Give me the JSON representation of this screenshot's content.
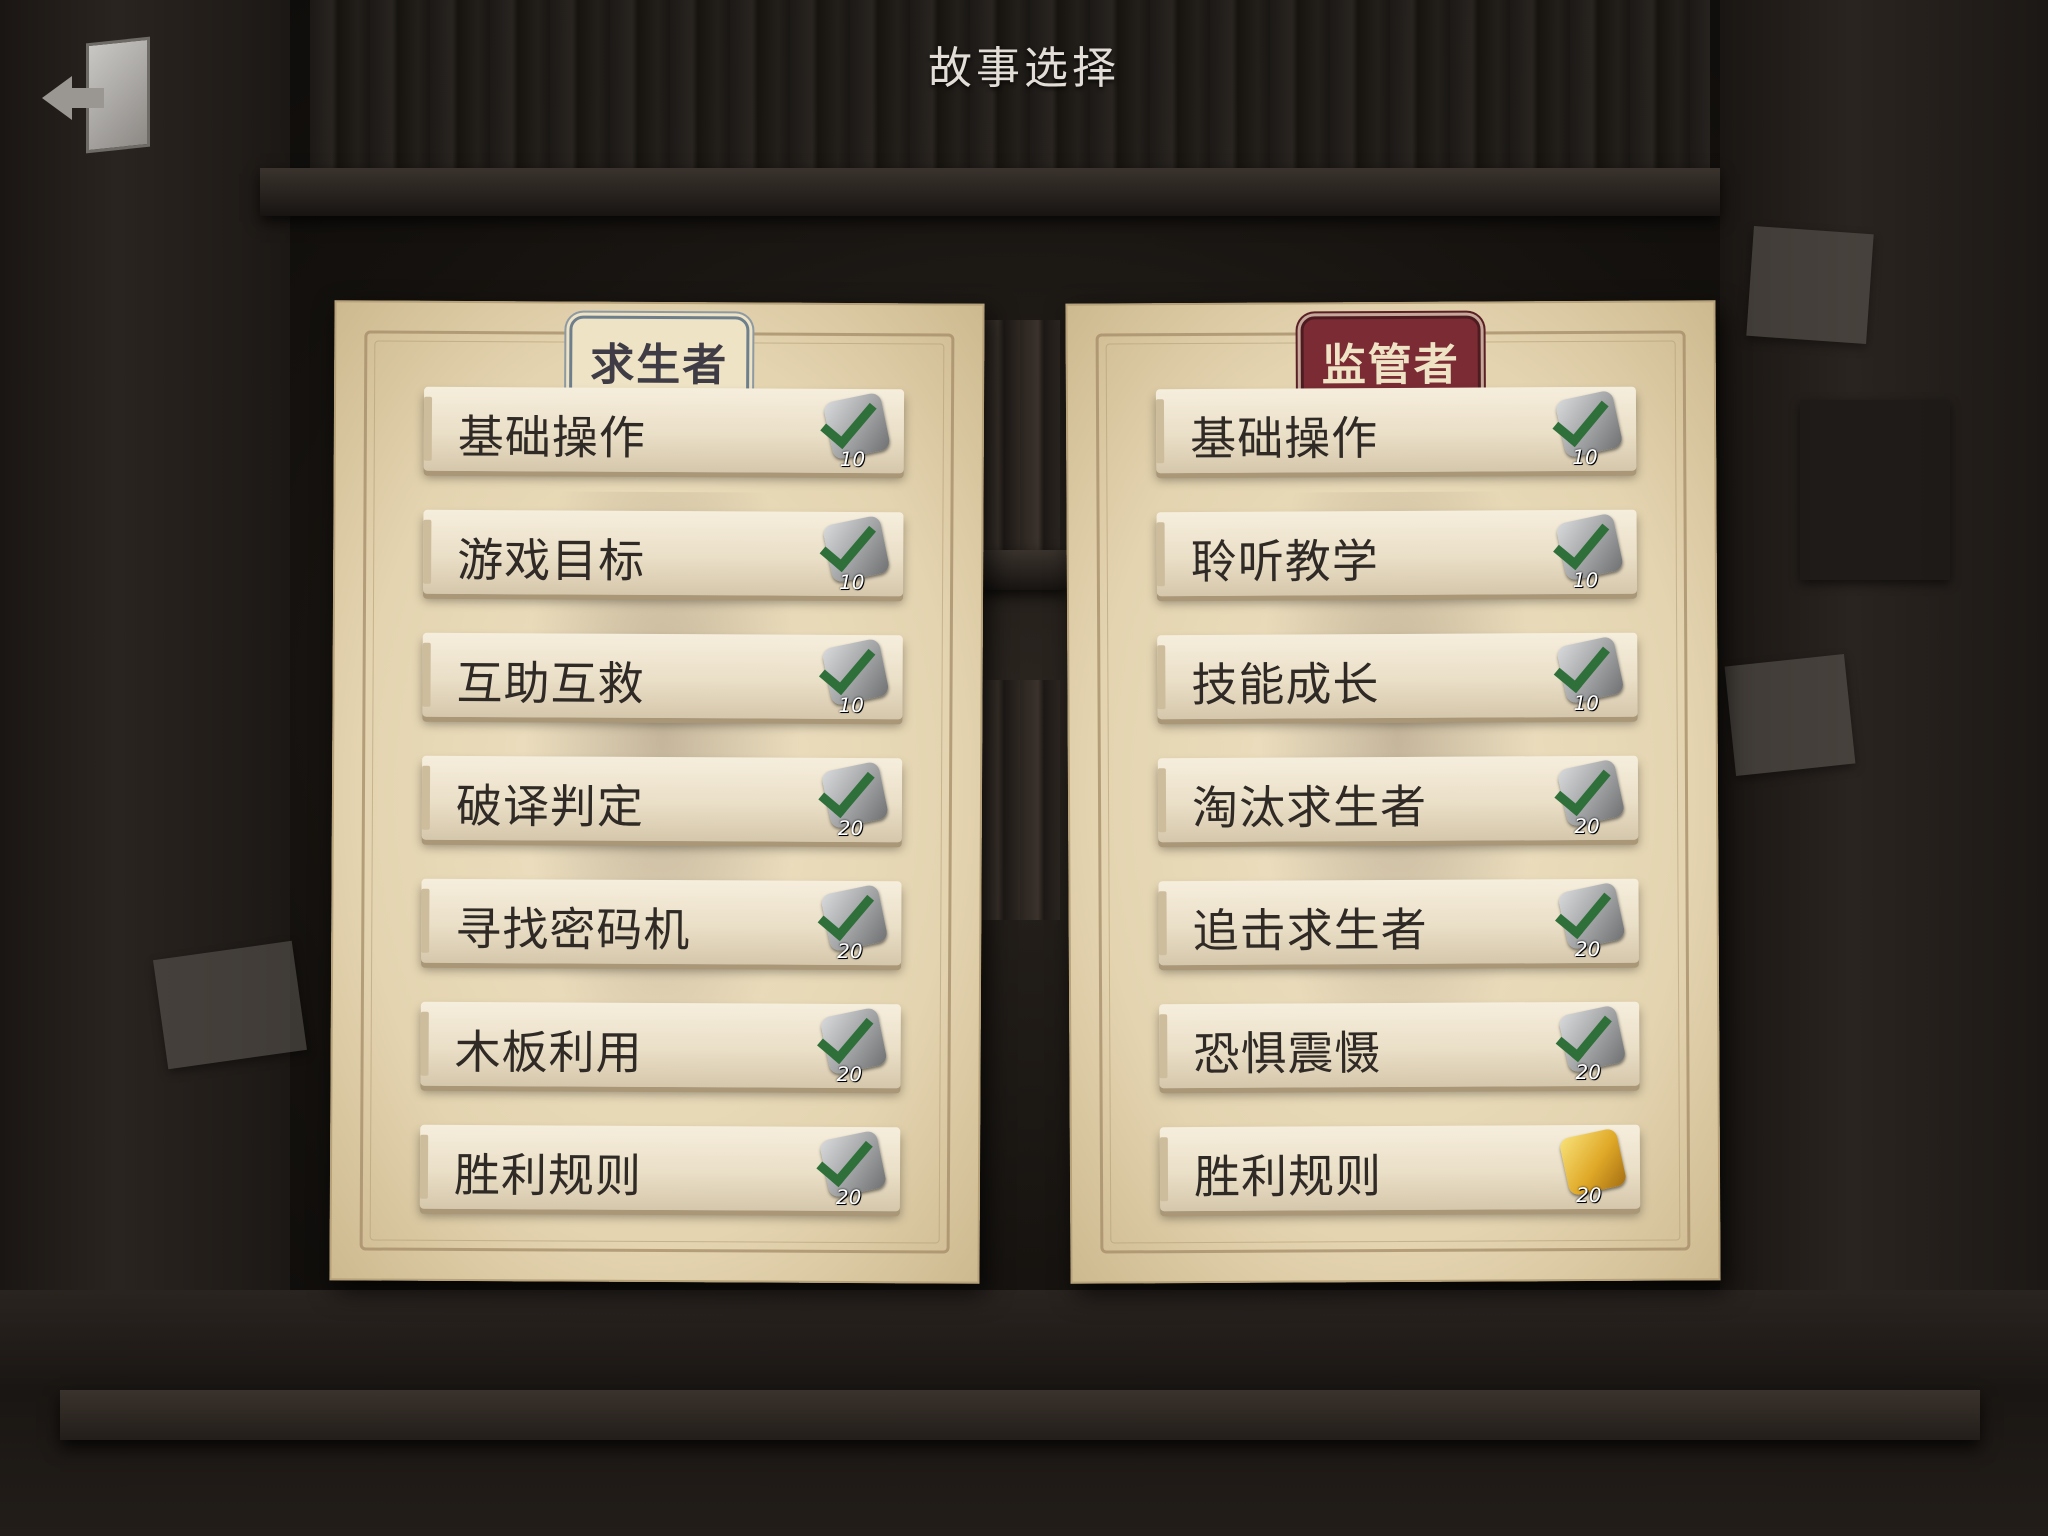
{
  "header": {
    "title": "故事选择"
  },
  "survivor_panel": {
    "title": "求生者",
    "items": [
      {
        "label": "基础操作",
        "points": "10",
        "piece_color": "silver"
      },
      {
        "label": "游戏目标",
        "points": "10",
        "piece_color": "silver"
      },
      {
        "label": "互助互救",
        "points": "10",
        "piece_color": "silver"
      },
      {
        "label": "破译判定",
        "points": "20",
        "piece_color": "silver"
      },
      {
        "label": "寻找密码机",
        "points": "20",
        "piece_color": "silver"
      },
      {
        "label": "木板利用",
        "points": "20",
        "piece_color": "silver"
      },
      {
        "label": "胜利规则",
        "points": "20",
        "piece_color": "silver"
      }
    ]
  },
  "hunter_panel": {
    "title": "监管者",
    "items": [
      {
        "label": "基础操作",
        "points": "10",
        "piece_color": "silver"
      },
      {
        "label": "聆听教学",
        "points": "10",
        "piece_color": "silver"
      },
      {
        "label": "技能成长",
        "points": "10",
        "piece_color": "silver"
      },
      {
        "label": "淘汰求生者",
        "points": "20",
        "piece_color": "silver"
      },
      {
        "label": "追击求生者",
        "points": "20",
        "piece_color": "silver"
      },
      {
        "label": "恐惧震慑",
        "points": "20",
        "piece_color": "silver"
      },
      {
        "label": "胜利规则",
        "points": "20",
        "piece_color": "gold"
      }
    ]
  },
  "colors": {
    "survivor_accent": "#6d7f8c",
    "hunter_accent": "#7a2b33",
    "check": "#2f6f3a",
    "parchment": "#e4d4b0"
  }
}
